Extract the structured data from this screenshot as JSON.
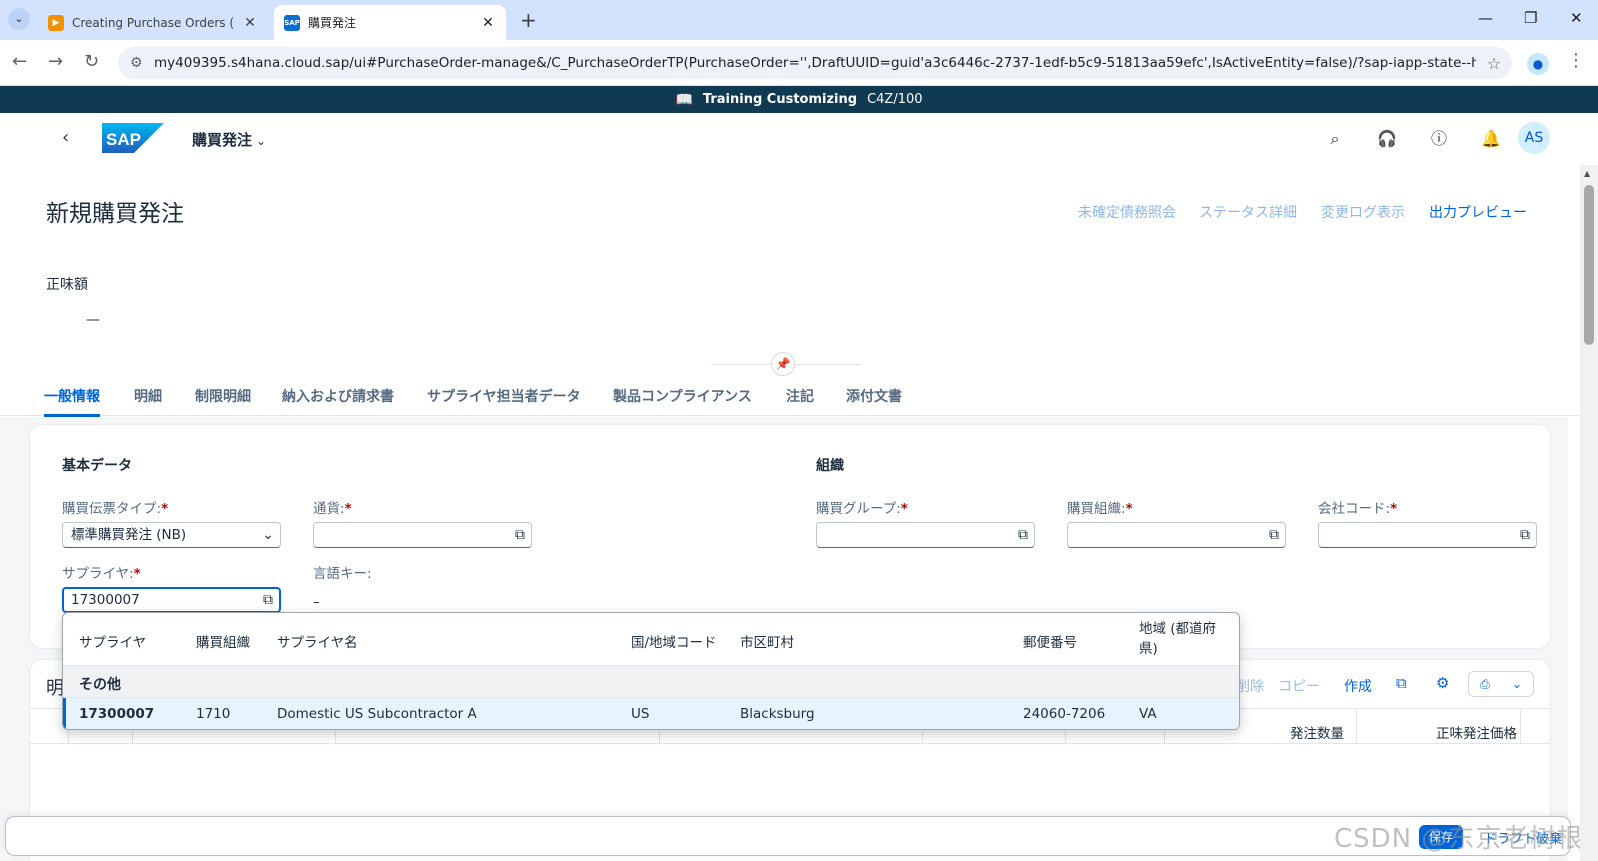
{
  "browser": {
    "tabs": [
      {
        "title": "Creating Purchase Orders (BMY",
        "active": false
      },
      {
        "title": "購買発注",
        "active": true
      }
    ],
    "url": "my409395.s4hana.cloud.sap/ui#PurchaseOrder-manage&/C_PurchaseOrderTP(PurchaseOrder='',DraftUUID=guid'a3c6446c-2737-1edf-b5c9-51813aa59efc',IsActiveEntity=false)/?sap-iapp-state--history=TASQGX...",
    "new_tab": "+",
    "profile_initial": "●"
  },
  "banner": {
    "label": "Training Customizing",
    "system": "C4Z/100"
  },
  "shell": {
    "app_title": "購買発注",
    "avatar": "AS",
    "logo_text": "SAP"
  },
  "header": {
    "title": "新規購買発注",
    "actions": [
      {
        "label": "未確定債務照会",
        "enabled": false
      },
      {
        "label": "ステータス詳細",
        "enabled": false
      },
      {
        "label": "変更ログ表示",
        "enabled": false
      },
      {
        "label": "出力プレビュー",
        "enabled": true
      }
    ],
    "kpi_label": "正味額",
    "kpi_value": "—"
  },
  "tabs": [
    {
      "label": "一般情報",
      "selected": true
    },
    {
      "label": "明細",
      "selected": false
    },
    {
      "label": "制限明細",
      "selected": false
    },
    {
      "label": "納入および請求書",
      "selected": false
    },
    {
      "label": "サプライヤ担当者データ",
      "selected": false
    },
    {
      "label": "製品コンプライアンス",
      "selected": false
    },
    {
      "label": "注記",
      "selected": false
    },
    {
      "label": "添付文書",
      "selected": false
    }
  ],
  "basic_data": {
    "title": "基本データ",
    "doc_type_label": "購買伝票タイプ:",
    "doc_type_value": "標準購買発注 (NB)",
    "currency_label": "通貨:",
    "currency_value": "",
    "supplier_label": "サプライヤ:",
    "supplier_value": "17300007",
    "language_label": "言語キー:",
    "language_value": "–"
  },
  "organization": {
    "title": "組織",
    "purchasing_group_label": "購買グループ:",
    "purchasing_org_label": "購買組織:",
    "company_code_label": "会社コード:",
    "required_marker": "*"
  },
  "suggestions": {
    "columns": [
      "サプライヤ",
      "購買組織",
      "サプライヤ名",
      "国/地域コード",
      "市区町村",
      "郵便番号",
      "地域 (都道府県)"
    ],
    "group": "その他",
    "rows": [
      {
        "supplier": "17300007",
        "purch_org": "1710",
        "name": "Domestic US Subcontractor A",
        "country": "US",
        "city": "Blacksburg",
        "postal": "24060-7206",
        "region": "VA"
      }
    ]
  },
  "items_table": {
    "title": "明",
    "actions": [
      {
        "label": "削除",
        "enabled": false
      },
      {
        "label": "コピー",
        "enabled": false
      },
      {
        "label": "作成",
        "enabled": true
      }
    ],
    "columns": [
      "発注数量",
      "正味発注価格"
    ]
  },
  "footer": {
    "button_label": "保存",
    "link_label": "ドラフト破棄"
  },
  "watermark": "CSDN @东京老树根",
  "colors": {
    "brand": "#0064d9",
    "banner": "#0f3a52",
    "required": "#aa0808"
  }
}
